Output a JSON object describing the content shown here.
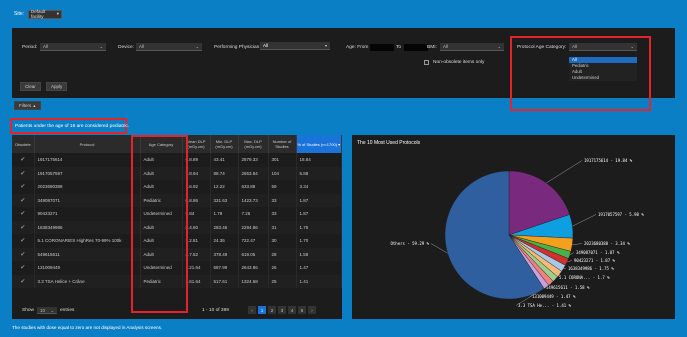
{
  "site": {
    "label": "Site:",
    "value": "Default facility"
  },
  "filters": {
    "period_label": "Period:",
    "period_value": "All",
    "device_label": "Device:",
    "device_value": "All",
    "physician_label": "Performing Physician:",
    "physician_value": "All",
    "age_from_label": "Age: From",
    "age_to_label": "To",
    "bmi_label": "BMI:",
    "bmi_value": "All",
    "nonobsolete_label": "Non-obsolete items only",
    "protocol_age_label": "Protocol Age Category:",
    "protocol_age_value": "All",
    "protocol_age_options": [
      "All",
      "Pediatric",
      "Adult",
      "Undetermined"
    ],
    "clear_label": "Clear",
    "apply_label": "Apply",
    "toggle_label": "Filters"
  },
  "pediatric_note": "Patients under the age of 16 are considered pediatric.",
  "table": {
    "headers": [
      "Obsolete",
      "Protocol",
      "Age Category",
      "Mean DLP (mGy.cm)",
      "Min. DLP (mGy.cm)",
      "Max. DLP (mGy.cm)",
      "Number of Studies",
      "% of Studies (n=1700)"
    ],
    "rows": [
      [
        "1917175614",
        "Adult",
        "6.8.89",
        "43.41",
        "2879.33",
        "301",
        "18.84"
      ],
      [
        "1917057597",
        "Adult",
        "7.8.94",
        "88.74",
        "2653.84",
        "104",
        "5.88"
      ],
      [
        "2023680388",
        "Adult",
        "1.6.92",
        "12.22",
        "633.88",
        "59",
        "3.34"
      ],
      [
        "349087071",
        "Pediatric",
        "6.8.86",
        "331.63",
        "1423.73",
        "33",
        "1.87"
      ],
      [
        "90423271",
        "Undetermined",
        "9.84",
        "1.79",
        "7.26",
        "33",
        "1.87"
      ],
      [
        "1638349986",
        "Adult",
        "8.4.60",
        "283.46",
        "2294.86",
        "31",
        "1.75"
      ],
      [
        "5.1 CORONARIES HighRes 70-99% 100k",
        "Adult",
        "1.2.81",
        "24.36",
        "722.47",
        "30",
        "1.70"
      ],
      [
        "549615611",
        "Adult",
        "4.7.52",
        "378.49",
        "619.05",
        "28",
        "1.58"
      ],
      [
        "131009449",
        "Undetermined",
        "1.21.64",
        "687.99",
        "2643.86",
        "26",
        "1.47"
      ],
      [
        "3.3 TSA Helice + Crâne",
        "Pediatric",
        "1.61.64",
        "517.61",
        "1324.68",
        "25",
        "1.41"
      ]
    ],
    "show_label": "Show",
    "show_value": "10",
    "entries_label": "entries",
    "page_info": "1 - 10 of 399",
    "pages": [
      "1",
      "2",
      "3",
      "4",
      "5"
    ]
  },
  "footer_note": "The studies with dose equal to zero are not displayed in Analysis screens.",
  "chart_data": {
    "type": "pie",
    "title": "The 10 Most Used Protocols",
    "series": [
      {
        "label": "1917175614 - 19.84 %",
        "value": 19.84,
        "color": "#7a2a7e"
      },
      {
        "label": "1917057597 - 5.98 %",
        "value": 5.98,
        "color": "#0e9fe0"
      },
      {
        "label": "2023680388 - 3.34 %",
        "value": 3.34,
        "color": "#f3a01f"
      },
      {
        "label": "349087071 - 1.87 %",
        "value": 1.87,
        "color": "#4bb04a"
      },
      {
        "label": "90423271 - 1.87 %",
        "value": 1.87,
        "color": "#d0312d"
      },
      {
        "label": "1638349986 - 1.75 %",
        "value": 1.75,
        "color": "#a9c8e8"
      },
      {
        "label": "5.1 CORONA... - 1.7 %",
        "value": 1.7,
        "color": "#f5b97a"
      },
      {
        "label": "549615611 - 1.58 %",
        "value": 1.58,
        "color": "#9ad08a"
      },
      {
        "label": "131009449 - 1.47 %",
        "value": 1.47,
        "color": "#f08080"
      },
      {
        "label": "3.3 TSA He... - 1.41 %",
        "value": 1.41,
        "color": "#c8a2d8"
      },
      {
        "label": "Others - 59.29 %",
        "value": 59.29,
        "color": "#2f5f9e"
      }
    ]
  }
}
